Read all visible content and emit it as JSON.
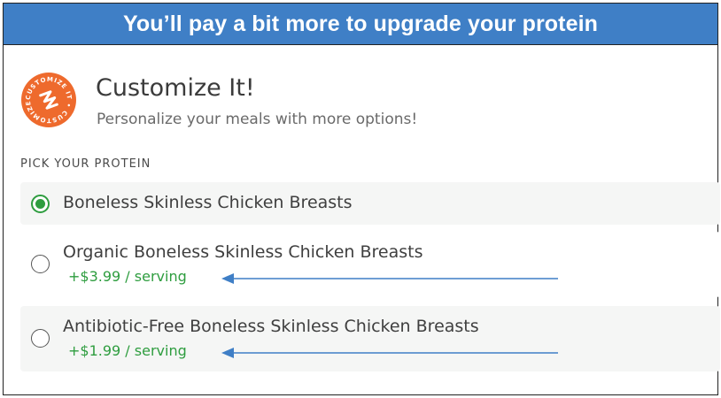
{
  "banner": {
    "text": "You’ll pay a bit more to upgrade your protein"
  },
  "header": {
    "badge_text": "CUSTOMIZE IT",
    "title": "Customize It!",
    "subtitle": "Personalize your meals with more options!"
  },
  "protein": {
    "section_label": "PICK YOUR PROTEIN",
    "options": [
      {
        "label": "Boneless Skinless Chicken Breasts",
        "price": "",
        "selected": true
      },
      {
        "label": "Organic Boneless Skinless Chicken Breasts",
        "price": "+$3.99 / serving",
        "selected": false
      },
      {
        "label": "Antibiotic-Free Boneless Skinless Chicken Breasts",
        "price": "+$1.99 / serving",
        "selected": false
      }
    ]
  },
  "colors": {
    "banner": "#3f7fc6",
    "badge": "#ee6a2d",
    "accent_green": "#2e9d3f",
    "arrow": "#3f7fc6"
  }
}
